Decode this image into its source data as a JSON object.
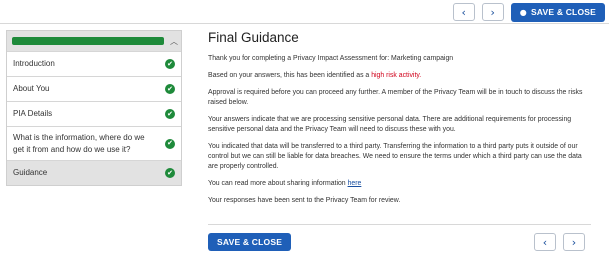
{
  "toolbar": {
    "prev_icon": "chevron-left-icon",
    "prev_glyph": "‹",
    "next_icon": "chevron-right-icon",
    "next_glyph": "›",
    "save_icon": "save-icon",
    "save_glyph": "●",
    "save_label": "SAVE & CLOSE"
  },
  "sidebar": {
    "progress": {
      "percent": 100,
      "color": "#1e8a3a"
    },
    "collapse_glyph": "︿",
    "items": [
      {
        "label": "Introduction",
        "complete": true
      },
      {
        "label": "About You",
        "complete": true
      },
      {
        "label": "PIA Details",
        "complete": true
      },
      {
        "label": "What is the information, where do we get it from and how do we use it?",
        "complete": true
      },
      {
        "label": "Guidance",
        "complete": true,
        "active": true
      }
    ],
    "check_glyph": "✔"
  },
  "main": {
    "title": "Final Guidance",
    "intro": "Thank you for completing a Privacy Impact Assessment for: Marketing campaign",
    "risk_prefix": "Based on your answers, this has been identified as a ",
    "risk_label": "high risk activity.",
    "approval": "Approval is required before you can proceed any further. A member of the Privacy Team will be in touch to discuss the risks raised below.",
    "sensitive": "Your answers indicate that we are processing sensitive personal data. There are additional requirements for processing sensitive personal data and the Privacy Team will need to discuss these with you.",
    "third_party": "You indicated that data will be transferred to a third party. Transferring the information to a third party puts it outside of our control but we can still be liable for data breaches. We need to ensure the terms under which a third party can use the data are properly controlled.",
    "read_more_prefix": "You can read more about sharing information ",
    "read_more_link": "here",
    "sent": "Your responses have been sent to the Privacy Team for review."
  },
  "colors": {
    "primary": "#1f5fb8",
    "success": "#1e8a3a",
    "risk": "#d0021b"
  }
}
